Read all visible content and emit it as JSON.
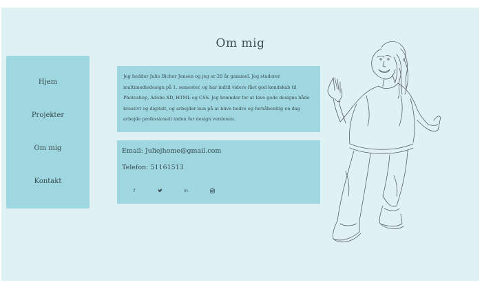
{
  "header": {
    "title": "Om mig"
  },
  "nav": {
    "items": [
      {
        "label": "Hjem"
      },
      {
        "label": "Projekter"
      },
      {
        "label": "Om mig"
      },
      {
        "label": "Kontakt"
      }
    ]
  },
  "about": {
    "text": "Jeg hedder Julie Bicher Jensen og jeg er 20 år gammel. Jeg studerer multimediedesign på 1. semester, og har indtil videre fået god kendskab til Photoshop, Adobe XD, HTML og CSS. Jeg brænder for at lave gode designs både kreativt og digitalt, og arbejder kun på at blive bedre og forhåbentlig en dag arbejde professionelt inden for design verdenen."
  },
  "contact": {
    "email": "Email: Juliejhome@gmail.com",
    "phone": "Telefon: 51161513"
  },
  "social": {
    "facebook": "f",
    "twitter": "🐦",
    "linkedin": "in",
    "instagram": "◎"
  },
  "icons": {
    "facebook": "facebook-icon",
    "twitter": "twitter-icon",
    "linkedin": "linkedin-icon",
    "instagram": "instagram-icon"
  },
  "colors": {
    "page_background": "#e0f1f4",
    "panel": "#9ed7e0",
    "text": "#3b4a50"
  }
}
